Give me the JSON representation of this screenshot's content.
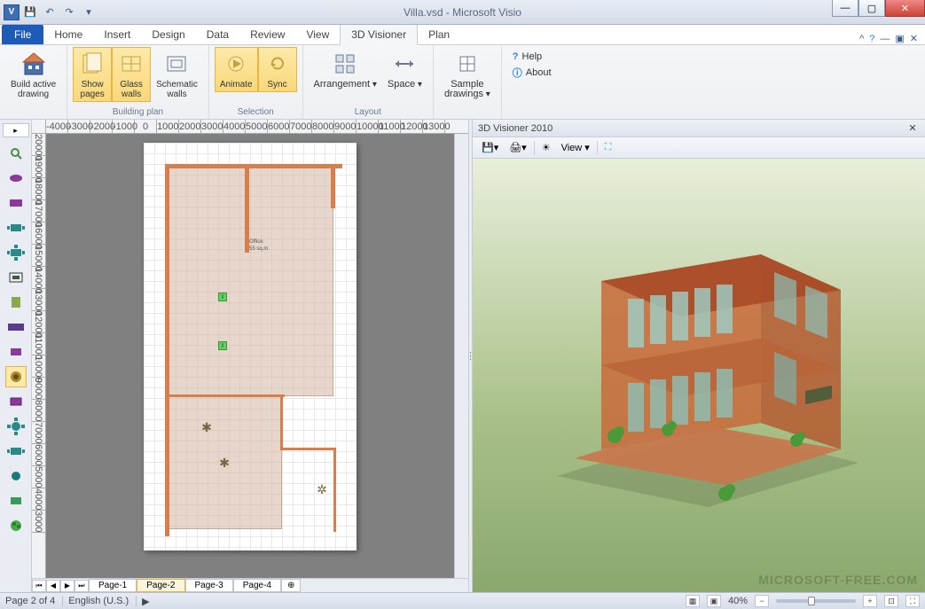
{
  "titlebar": {
    "app_icon_letter": "V",
    "title": "Villa.vsd - Microsoft Visio"
  },
  "menutabs": {
    "file": "File",
    "tabs": [
      "Home",
      "Insert",
      "Design",
      "Data",
      "Review",
      "View",
      "3D Visioner",
      "Plan"
    ],
    "active": "3D Visioner"
  },
  "ribbon": {
    "groups": [
      {
        "label": "",
        "buttons": [
          {
            "label": "Build active\ndrawing",
            "icon": "🏗"
          }
        ]
      },
      {
        "label": "Building plan",
        "buttons": [
          {
            "label": "Show\npages",
            "icon": "▭",
            "selected": true
          },
          {
            "label": "Glass\nwalls",
            "icon": "▥",
            "selected": true
          },
          {
            "label": "Schematic\nwalls",
            "icon": "▦"
          }
        ]
      },
      {
        "label": "Selection",
        "buttons": [
          {
            "label": "Animate",
            "icon": "✦",
            "selected": true
          },
          {
            "label": "Sync",
            "icon": "⟳",
            "selected": true
          }
        ]
      },
      {
        "label": "Layout",
        "buttons": [
          {
            "label": "Arrangement",
            "icon": "▤",
            "dropdown": true
          },
          {
            "label": "Space",
            "icon": "↔",
            "dropdown": true
          }
        ]
      },
      {
        "label": "",
        "buttons": [
          {
            "label": "Sample\ndrawings",
            "icon": "📐",
            "dropdown": true
          }
        ]
      }
    ],
    "help_items": [
      "Help",
      "About"
    ]
  },
  "ruler_h": [
    "-4000",
    "-3000",
    "-2000",
    "-1000",
    "0",
    "1000",
    "2000",
    "3000",
    "4000",
    "5000",
    "6000",
    "7000",
    "8000",
    "9000",
    "10000",
    "11000",
    "12000",
    "13000"
  ],
  "ruler_v": [
    "20000",
    "19000",
    "18000",
    "17000",
    "16000",
    "15000",
    "14000",
    "13000",
    "12000",
    "11000",
    "10000",
    "9000",
    "8000",
    "7000",
    "6000",
    "5000",
    "4000",
    "3000"
  ],
  "floor_labels": {
    "room": "Office",
    "area": "55 sq.m"
  },
  "page_tabs": [
    "Page-1",
    "Page-2",
    "Page-3",
    "Page-4"
  ],
  "page_tab_active": "Page-2",
  "panel3d": {
    "title": "3D Visioner 2010",
    "view_label": "View"
  },
  "statusbar": {
    "page": "Page 2 of 4",
    "lang": "English (U.S.)",
    "zoom": "40%"
  },
  "watermark": "MICROSOFT-FREE.COM"
}
